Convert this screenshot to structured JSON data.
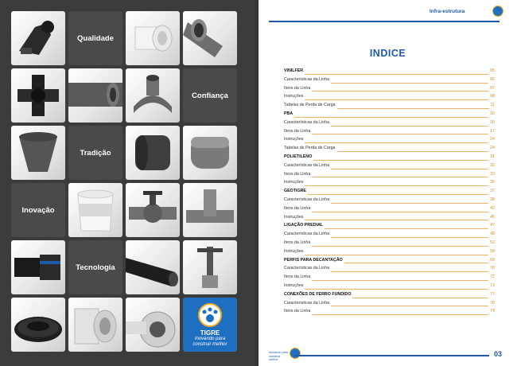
{
  "left_page": {
    "labels": {
      "qualidade": "Qualidade",
      "confianca": "Confiança",
      "tradicao": "Tradição",
      "inovacao": "Inovação",
      "tecnologia": "Tecnologia"
    },
    "brand": {
      "name": "TIGRE",
      "slogan_line1": "Inovando para",
      "slogan_line2": "construir melhor"
    },
    "colors": {
      "background": "#3c3c3c",
      "brand_blue": "#1f6fc1",
      "tile_label": "#4a4a4a"
    }
  },
  "right_page": {
    "header": {
      "text": "Infra-estrutura"
    },
    "title": "INDICE",
    "toc": [
      {
        "title": "VINILFER",
        "page": "05",
        "section": true
      },
      {
        "title": "Características da Linha",
        "page": "06",
        "section": false
      },
      {
        "title": "Itens da Linha",
        "page": "07",
        "section": false
      },
      {
        "title": "Instruções",
        "page": "08",
        "section": false
      },
      {
        "title": "Tabelas de Perda de Carga",
        "page": "11",
        "section": false
      },
      {
        "title": "PBA",
        "page": "15",
        "section": true
      },
      {
        "title": "Características da Linha",
        "page": "16",
        "section": false
      },
      {
        "title": "Itens da Linha",
        "page": "17",
        "section": false
      },
      {
        "title": "Instruções",
        "page": "24",
        "section": false
      },
      {
        "title": "Tabelas de Perda de Carga",
        "page": "24",
        "section": false
      },
      {
        "title": "POLIETILENO",
        "page": "31",
        "section": true
      },
      {
        "title": "Características da Linha",
        "page": "32",
        "section": false
      },
      {
        "title": "Itens da Linha",
        "page": "33",
        "section": false
      },
      {
        "title": "Instruções",
        "page": "35",
        "section": false
      },
      {
        "title": "GEOTIGRE",
        "page": "37",
        "section": true
      },
      {
        "title": "Características da Linha",
        "page": "38",
        "section": false
      },
      {
        "title": "Itens da Linha",
        "page": "42",
        "section": false
      },
      {
        "title": "Instruções",
        "page": "45",
        "section": false
      },
      {
        "title": "LIGAÇÃO PREDIAL",
        "page": "47",
        "section": true
      },
      {
        "title": "Características da Linha",
        "page": "48",
        "section": false
      },
      {
        "title": "Itens da Linha",
        "page": "52",
        "section": false
      },
      {
        "title": "Instruções",
        "page": "59",
        "section": false
      },
      {
        "title": "PERFIS PARA DECANTAÇÃO",
        "page": "69",
        "section": true
      },
      {
        "title": "Características da Linha",
        "page": "70",
        "section": false
      },
      {
        "title": "Itens da Linha",
        "page": "72",
        "section": false
      },
      {
        "title": "Instruções",
        "page": "73",
        "section": false
      },
      {
        "title": "CONEXÕES DE FERRO FUNDIDO",
        "page": "77",
        "section": true
      },
      {
        "title": "Características da Linha",
        "page": "78",
        "section": false
      },
      {
        "title": "Itens da Linha",
        "page": "79",
        "section": false
      }
    ],
    "footer": {
      "page_number": "03",
      "tagline_line1": "Inovando para",
      "tagline_line2": "construir melhor"
    },
    "colors": {
      "title_blue": "#1e5aa8",
      "page_orange": "#e08a1c",
      "leader": "#f0b46a"
    }
  }
}
